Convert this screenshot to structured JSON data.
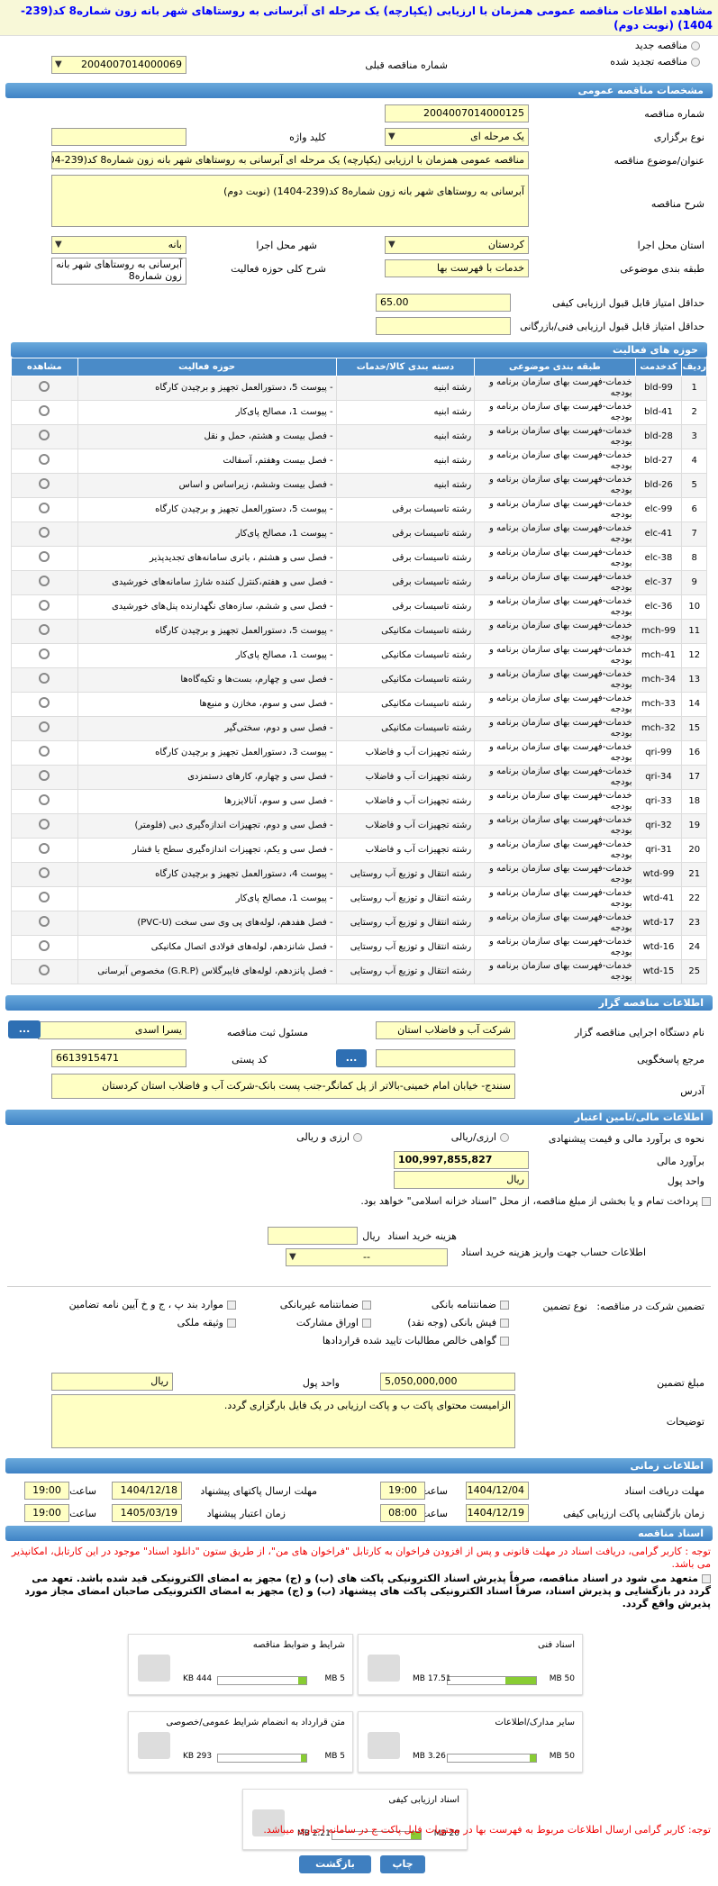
{
  "page": {
    "title": "مشاهده اطلاعات مناقصه عمومی همزمان با ارزیابی (یکپارچه) یک مرحله ای آبرسانی به روستاهای شهر بانه زون شماره8 کد(239-1404) (نوبت دوم)"
  },
  "top": {
    "new_label": "مناقصه جدید",
    "renew_label": "مناقصه تجدید شده",
    "prev_label": "شماره مناقصه قبلی",
    "prev_value": "2004007014000069"
  },
  "general": {
    "header": "مشخصات مناقصه عمومی",
    "number_label": "شماره مناقصه",
    "number": "2004007014000125",
    "type_label": "نوع برگزاری",
    "type": "یک مرحله ای",
    "keyword_label": "کلید واژه",
    "keyword": "",
    "subject_label": "عنوان/موضوع مناقصه",
    "subject": "مناقصه عمومی همزمان با ارزیابی (یکپارچه) یک مرحله ای آبرسانی به روستاهای شهر بانه زون شماره8 کد(239-1404) (نوبت دوم)",
    "desc_label": "شرح مناقصه",
    "desc": "آبرسانی به روستاهای شهر بانه زون شماره8 کد(239-1404) (نوبت دوم)",
    "province_label": "استان محل اجرا",
    "province": "کردستان",
    "city_label": "شهر محل اجرا",
    "city": "بانه",
    "category_label": "طبقه بندی موضوعی",
    "category": "خدمات با فهرست بها",
    "scope_label": "شرح کلی حوزه فعالیت",
    "scope": "آبرسانی به روستاهای شهر بانه زون شماره8",
    "min_quality_label": "حداقل امتیاز قابل قبول ارزیابی کیفی",
    "min_quality": "65.00",
    "min_tech_label": "حداقل امتیاز قابل قبول ارزیابی فنی/بازرگانی",
    "min_tech": ""
  },
  "activity": {
    "header": "حوزه های فعالیت",
    "cols": [
      "ردیف",
      "کدخدمت",
      "طبقه بندی موضوعی",
      "دسته بندی کالا/خدمات",
      "حوزه فعالیت",
      "مشاهده"
    ],
    "rows": [
      [
        "1",
        "bld-99",
        "خدمات-فهرست بهای سازمان برنامه و بودجه",
        "رشته ابنیه",
        "- پیوست 5، دستورالعمل تجهیز و برچیدن کارگاه"
      ],
      [
        "2",
        "bld-41",
        "خدمات-فهرست بهای سازمان برنامه و بودجه",
        "رشته ابنیه",
        "- پیوست 1، مصالح پای‌کار"
      ],
      [
        "3",
        "bld-28",
        "خدمات-فهرست بهای سازمان برنامه و بودجه",
        "رشته ابنیه",
        "- فصل بیست و هشتم، حمل و نقل"
      ],
      [
        "4",
        "bld-27",
        "خدمات-فهرست بهای سازمان برنامه و بودجه",
        "رشته ابنیه",
        "- فصل بیست وهفتم، آسفالت"
      ],
      [
        "5",
        "bld-26",
        "خدمات-فهرست بهای سازمان برنامه و بودجه",
        "رشته ابنیه",
        "- فصل بیست وششم، زیراساس و اساس"
      ],
      [
        "6",
        "elc-99",
        "خدمات-فهرست بهای سازمان برنامه و بودجه",
        "رشته تاسیسات برقی",
        "- پیوست 5، دستورالعمل تجهیز و برچیدن کارگاه"
      ],
      [
        "7",
        "elc-41",
        "خدمات-فهرست بهای سازمان برنامه و بودجه",
        "رشته تاسیسات برقی",
        "- پیوست 1، مصالح پای‌کار"
      ],
      [
        "8",
        "elc-38",
        "خدمات-فهرست بهای سازمان برنامه و بودجه",
        "رشته تاسیسات برقی",
        "- فصل سی و هشتم ، باتری سامانه‌های تجدیدپذیر"
      ],
      [
        "9",
        "elc-37",
        "خدمات-فهرست بهای سازمان برنامه و بودجه",
        "رشته تاسیسات برقی",
        "- فصل سی و هفتم،کنترل کننده شارژ سامانه‌های خورشیدی"
      ],
      [
        "10",
        "elc-36",
        "خدمات-فهرست بهای سازمان برنامه و بودجه",
        "رشته تاسیسات برقی",
        "- فصل سی و ششم، سازه‌های نگهدارنده پنل‌های خورشیدی"
      ],
      [
        "11",
        "mch-99",
        "خدمات-فهرست بهای سازمان برنامه و بودجه",
        "رشته تاسیسات مکانیکی",
        "- پیوست 5، دستورالعمل تجهیز و برچیدن کارگاه"
      ],
      [
        "12",
        "mch-41",
        "خدمات-فهرست بهای سازمان برنامه و بودجه",
        "رشته تاسیسات مکانیکی",
        "- پیوست 1، مصالح پای‌کار"
      ],
      [
        "13",
        "mch-34",
        "خدمات-فهرست بهای سازمان برنامه و بودجه",
        "رشته تاسیسات مکانیکی",
        "- فصل سی و چهارم، بست‌ها و تکیه‌گاه‌ها"
      ],
      [
        "14",
        "mch-33",
        "خدمات-فهرست بهای سازمان برنامه و بودجه",
        "رشته تاسیسات مکانیکی",
        "- فصل سی و سوم، مخازن و منبع‌ها"
      ],
      [
        "15",
        "mch-32",
        "خدمات-فهرست بهای سازمان برنامه و بودجه",
        "رشته تاسیسات مکانیکی",
        "- فصل سی و دوم، سختی‌گیر"
      ],
      [
        "16",
        "qri-99",
        "خدمات-فهرست بهای سازمان برنامه و بودجه",
        "رشته تجهیزات آب و فاضلاب",
        "- پیوست 3، دستورالعمل تجهیز و برچیدن کارگاه"
      ],
      [
        "17",
        "qri-34",
        "خدمات-فهرست بهای سازمان برنامه و بودجه",
        "رشته تجهیزات آب و فاضلاب",
        "- فصل سی و چهارم، کارهای دستمزدی"
      ],
      [
        "18",
        "qri-33",
        "خدمات-فهرست بهای سازمان برنامه و بودجه",
        "رشته تجهیزات آب و فاضلاب",
        "- فصل سی و سوم، آنالایزرها"
      ],
      [
        "19",
        "qri-32",
        "خدمات-فهرست بهای سازمان برنامه و بودجه",
        "رشته تجهیزات آب و فاضلاب",
        "- فصل سی و دوم، تجهیزات اندازه‌گیری دبی (فلومتر)"
      ],
      [
        "20",
        "qri-31",
        "خدمات-فهرست بهای سازمان برنامه و بودجه",
        "رشته تجهیزات آب و فاضلاب",
        "- فصل سی و یکم، تجهیزات اندازه‌گیری سطح یا فشار"
      ],
      [
        "21",
        "wtd-99",
        "خدمات-فهرست بهای سازمان برنامه و بودجه",
        "رشته انتقال و توزیع آب روستایی",
        "- پیوست 4، دستورالعمل تجهیز و برچیدن کارگاه"
      ],
      [
        "22",
        "wtd-41",
        "خدمات-فهرست بهای سازمان برنامه و بودجه",
        "رشته انتقال و توزیع آب روستایی",
        "- پیوست 1، مصالح پای‌کار"
      ],
      [
        "23",
        "wtd-17",
        "خدمات-فهرست بهای سازمان برنامه و بودجه",
        "رشته انتقال و توزیع آب روستایی",
        "- فصل هفدهم، لوله‌های پی وی سی سخت (PVC-U)"
      ],
      [
        "24",
        "wtd-16",
        "خدمات-فهرست بهای سازمان برنامه و بودجه",
        "رشته انتقال و توزیع آب روستایی",
        "- فصل شانزدهم، لوله‌های فولادی اتصال مکانیکی"
      ],
      [
        "25",
        "wtd-15",
        "خدمات-فهرست بهای سازمان برنامه و بودجه",
        "رشته انتقال و توزیع آب روستایی",
        "- فصل پانزدهم، لوله‌های فایبرگلاس (G.R.P) مخصوص آبرسانی"
      ]
    ]
  },
  "organizer": {
    "header": "اطلاعات مناقصه گزار",
    "org_label": "نام دستگاه اجرایی مناقصه گزار",
    "org": "شرکت آب و فاضلاب استان",
    "resp_label": "مسئول ثبت مناقصه",
    "resp": "یسرا اسدی",
    "ref_label": "مرجع پاسخگویی",
    "ref": "",
    "postal_label": "کد پستی",
    "postal": "6613915471",
    "address_label": "آدرس",
    "address": "سنندج- خیابان امام خمینی-بالاتر از پل کمانگر-جنب پست بانک-شرکت آب و فاضلاب استان کردستان",
    "btn": "..."
  },
  "finance": {
    "header": "اطلاعات مالی/تامین اعتبار",
    "estimate_label": "نحوه ی برآورد مالی و قیمت پیشنهادی",
    "opt1": "ارزی/ریالی",
    "opt2": "ارزی و ریالی",
    "budget_label": "برآورد مالی",
    "budget": "100,997,855,827",
    "unit_label": "واحد پول",
    "unit": "ریال",
    "treasury": "پرداخت تمام و یا بخشی از مبلغ مناقصه، از محل \"اسناد خزانه اسلامی\" خواهد بود.",
    "doc_cost_label": "هزینه خرید اسناد",
    "doc_cost_unit": "ریال",
    "account_label": "اطلاعات حساب جهت واریز هزینه خرید اسناد",
    "account": "--"
  },
  "guarantee": {
    "type_label": "تضمین شرکت در مناقصه:",
    "kind_label": "نوع تضمین",
    "items": [
      "ضمانتنامه بانکی",
      "ضمانتنامه غیربانکی",
      "موارد بند پ ، ج و خ آیین نامه تضامین",
      "فیش بانکی (وجه نقد)",
      "اوراق مشارکت",
      "وثیقه ملکی",
      "گواهی خالص مطالبات تایید شده قراردادها"
    ],
    "amount_label": "مبلغ تضمین",
    "amount": "5,050,000,000",
    "unit_label": "واحد پول",
    "unit": "ریال",
    "notes_label": "توضیحات",
    "notes": "الزامیست محتوای پاکت ب و پاکت ارزیابی در یک فایل بارگزاری گردد."
  },
  "timing": {
    "header": "اطلاعات زمانی",
    "recv_label": "مهلت دریافت اسناد",
    "recv_date": "1404/12/04",
    "recv_time": "19:00",
    "send_label": "مهلت ارسال پاکتهای پیشنهاد",
    "send_date": "1404/12/18",
    "send_time": "19:00",
    "open_label": "زمان بازگشایی پاکت ارزیابی کیفی",
    "open_date": "1404/12/19",
    "open_time": "08:00",
    "valid_label": "زمان اعتبار پیشنهاد",
    "valid_date": "1405/03/19",
    "valid_time": "19:00",
    "time_label": "ساعت"
  },
  "docs": {
    "header": "اسناد مناقصه",
    "note1": "توجه : کاربر گرامی، دریافت اسناد در مهلت قانونی و پس از افزودن فراخوان به کارتابل \"فراخوان های من\"، از طریق ستون \"دانلود اسناد\" موجود در این کارتابل، امکانپذیر می باشد.",
    "note2": "متعهد می شود در اسناد مناقصه، صرفاً پذیرش اسناد الکترونیکی پاکت های (ب) و (ج) مجهز به امضای الکترونیکی قید شده باشد. تعهد می گردد در بازگشایی و پذیرش اسناد، صرفاً اسناد الکترونیکی پاکت های پیشنهاد (ب) و (ج) مجهز به امضای الکترونیکی صاحبان امضای مجاز مورد پذیرش واقع گردد.",
    "cards": [
      {
        "title": "شرایط و ضوابط مناقصه",
        "size": "444 KB",
        "max": "5 MB",
        "pct": 9
      },
      {
        "title": "اسناد فنی",
        "size": "17.51 MB",
        "max": "50 MB",
        "pct": 35
      },
      {
        "title": "متن قرارداد به انضمام شرایط عمومی/خصوصی",
        "size": "293 KB",
        "max": "5 MB",
        "pct": 6
      },
      {
        "title": "سایر مدارک/اطلاعات",
        "size": "3.26 MB",
        "max": "50 MB",
        "pct": 7
      },
      {
        "title": "اسناد ارزیابی کیفی",
        "size": "2.21 MB",
        "max": "20 MB",
        "pct": 11
      }
    ],
    "note3": "توجه: کاربر گرامی ارسال اطلاعات مربوط به فهرست بها در محتویات فایل پاکت ج در سامانه اجباری میباشد."
  },
  "buttons": {
    "print": "چاپ",
    "back": "بازگشت"
  }
}
